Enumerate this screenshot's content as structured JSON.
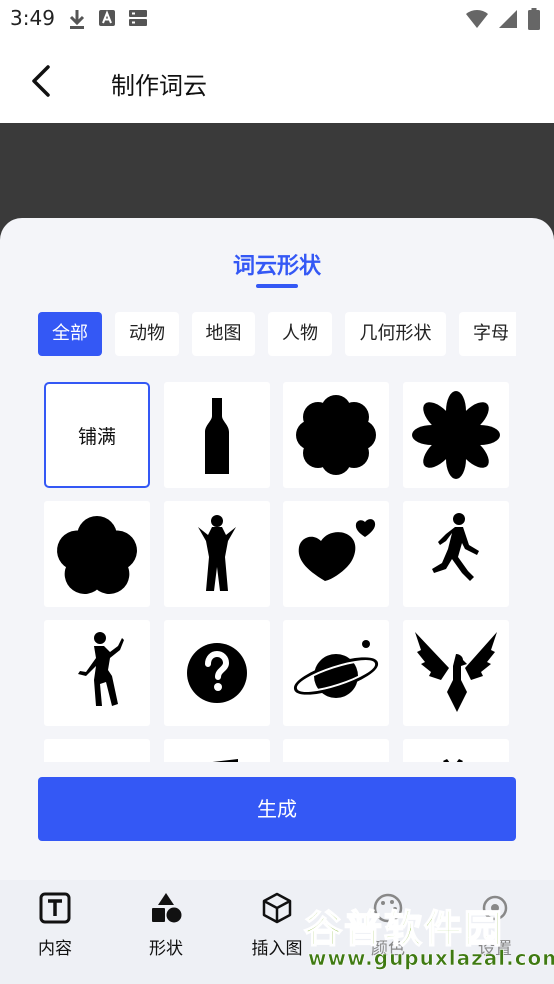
{
  "status": {
    "time": "3:49"
  },
  "appbar": {
    "title": "制作词云"
  },
  "sheet": {
    "title": "词云形状",
    "categories": [
      "全部",
      "动物",
      "地图",
      "人物",
      "几何形状",
      "字母"
    ],
    "selected_category": "全部",
    "fill_label": "铺满",
    "shapes": [
      "bottle-shape",
      "cloud-flower-shape",
      "eight-petal-flower-shape",
      "five-petal-flower-shape",
      "woman-silhouette-shape",
      "hearts-shape",
      "walking-man-shape",
      "dancing-man-shape",
      "question-mark-shape",
      "planet-shape",
      "eagle-shape"
    ],
    "generate_label": "生成"
  },
  "bottomnav": {
    "items": [
      {
        "label": "内容",
        "icon": "text-box-icon"
      },
      {
        "label": "形状",
        "icon": "shapes-icon"
      },
      {
        "label": "插入图",
        "icon": "cube-icon"
      },
      {
        "label": "颜色",
        "icon": "palette-icon"
      },
      {
        "label": "设置",
        "icon": "settings-icon"
      }
    ]
  },
  "watermark": {
    "text": "谷普软件园",
    "url": "www.gupuxlazal.com"
  },
  "colors": {
    "accent": "#3458f5",
    "preview_bg": "#3a3a3a",
    "sheet_bg": "#f4f5f9"
  }
}
